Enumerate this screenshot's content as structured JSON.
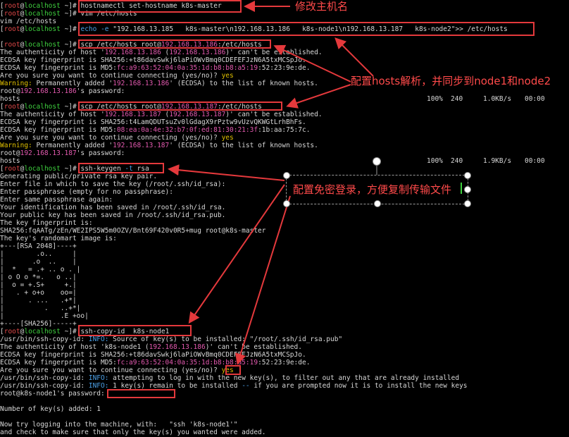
{
  "prompt": {
    "open": "[",
    "user": "root",
    "at": "@",
    "host": "localhost",
    "dir": " ~",
    "close": "]#"
  },
  "cmd": {
    "hostname": "hostnamectl set-hostname k8s-master",
    "vim": "vim /etc/hosts",
    "vim_echo": "vim /etc/hosts",
    "echo_kw": "echo -e",
    "echo_str": "\"192.168.13.185   k8s-master\\n192.168.13.186   k8s-node1\\n192.168.13.187   k8s-node2\"",
    "echo_tail": ">> /etc/hosts",
    "scp1": "scp /etc/hosts root@",
    "scp1_ip": "192.168.13.186",
    "scp1_tail": ":/etc/hosts",
    "scp2": "scp /etc/hosts root@",
    "scp2_ip": "192.168.13.187",
    "scp2_tail": ":/etc/hosts",
    "keygen": "ssh-keygen",
    "keygen_opt": " -t",
    "keygen_arg": " rsa",
    "copyid": "ssh-copy-id  k8s-node1"
  },
  "scp1_out": {
    "l1a": "The authenticity of host '",
    "ip": "192.168.13.186",
    "l1b": " (",
    "l1c": ")' can't be established.",
    "l2a": "ECDSA key fingerprint is SHA256:+t86davSwkj6laPiOWvBmq0CDEFEFJzN6A5txMCSpJo.",
    "l3a": "ECDSA key fingerprint is MD5:",
    "md5": "fc:a9:63:52:04:0a:35:1d:b8:b8:a5:19",
    "md5_tail": ":52:23:9e:de.",
    "confirm": "Are you sure you want to continue connecting (yes/no)? ",
    "yes": "yes",
    "warn": "Warning:",
    "warn_a": " Permanently added '",
    "warn_b": "' (ECDSA) to the list of known hosts.",
    "pw_a": "root@",
    "pw_b": "'s password:",
    "file": "hosts",
    "pct": "100%",
    "size": "240",
    "rate": "1.0KB/s",
    "eta": "00:00"
  },
  "scp2_out": {
    "l1a": "The authenticity of host '",
    "ip": "192.168.13.187",
    "l1b": " (",
    "l1c": ")' can't be established.",
    "l2a": "ECDSA key fingerprint is SHA256:t4LamQDUTsuZv0lGdagX9rPztw9vUzvQKWGtLrhBhFs.",
    "l3a": "ECDSA key fingerprint is MD5:",
    "md5": "08:ea:0a:4e:32:b7:0f:ed:81:30:21:3f",
    "md5_tail": ":1b:aa:75:7c.",
    "confirm": "Are you sure you want to continue connecting (yes/no)? ",
    "yes": "yes",
    "warn": "Warning:",
    "warn_a": " Permanently added '",
    "warn_b": "' (ECDSA) to the list of known hosts.",
    "pw_a": "root@",
    "pw_b": "'s password:",
    "file": "hosts",
    "pct": "100%",
    "size": "240",
    "rate": "1.9KB/s",
    "eta": "00:00"
  },
  "keygen_out": [
    "Generating public/private rsa key pair.",
    "Enter file in which to save the key (/root/.ssh/id_rsa):",
    "Enter passphrase (empty for no passphrase):",
    "Enter same passphrase again:",
    "Your identification has been saved in /root/.ssh/id_rsa.",
    "Your public key has been saved in /root/.ssh/id_rsa.pub.",
    "The key fingerprint is:",
    "SHA256:fqAATg/zEn/WE2IPS5W5m0OZV/Bnt69F420v0R5+mug root@k8s-master",
    "The key's randomart image is:",
    "+---[RSA 2048]----+",
    "|        .o..     |",
    "|       .o  ..    |",
    "|  *   = .+ .. o . |",
    "| o O o *=.   o ..|",
    "|  o = +.S+     +.|",
    "|   . + o+o    oo=|",
    "|      . ...   .+*|",
    "|          .   ..+*|",
    "|              .E +oo|",
    "+----[SHA256]-----+"
  ],
  "copyid_out": {
    "p1": "/usr/bin/ssh-copy-id: ",
    "info": "INFO:",
    "p1b": " Source of key(s) to be installed: \"/root/.ssh/id_rsa.pub\"",
    "auth_a": "The authenticity of host 'k8s-node1 (",
    "ip": "192.168.13.186",
    "auth_b": ")' can't be established.",
    "sha": "ECDSA key fingerprint is SHA256:+t86davSwkj6laPiOWvBmq0CDEFEFJzN6A5txMCSpJo.",
    "md5a": "ECDSA key fingerprint is MD5:",
    "md5": "fc:a9:63:52:04:0a:35:1d:b8:b8:a5:19",
    "md5_tail": ":52:23:9e:de.",
    "confirm": "Are you sure you want to continue connecting (yes/no)? ",
    "yes": "yes",
    "p3b": " attempting to log in with the new key(s), to filter out any that are already installed",
    "p4b": " 1 key(s) remain to be installed ",
    "dash": "--",
    "p4c": " if you are prompted now it is to install the new keys",
    "pw": "root@k8s-node1's password:",
    "added": "Number of key(s) added: 1",
    "try_a": "Now try logging into the machine, with:   \"ssh 'k8s-node1'\"",
    "try_b": "and check to make sure that only the key(s) you wanted were added."
  },
  "annotations": {
    "hostname": "修改主机名",
    "hosts": "配置hosts解析，并同步到node1和node2",
    "nopass": "配置免密登录，方便复制传输文件"
  },
  "colors": {
    "accent": "#e4393c",
    "prompt_user": "#e04848",
    "prompt_host": "#3fd23f",
    "yes": "#e0c000",
    "ip": "#e45ab0",
    "info": "#4ca0e6"
  }
}
